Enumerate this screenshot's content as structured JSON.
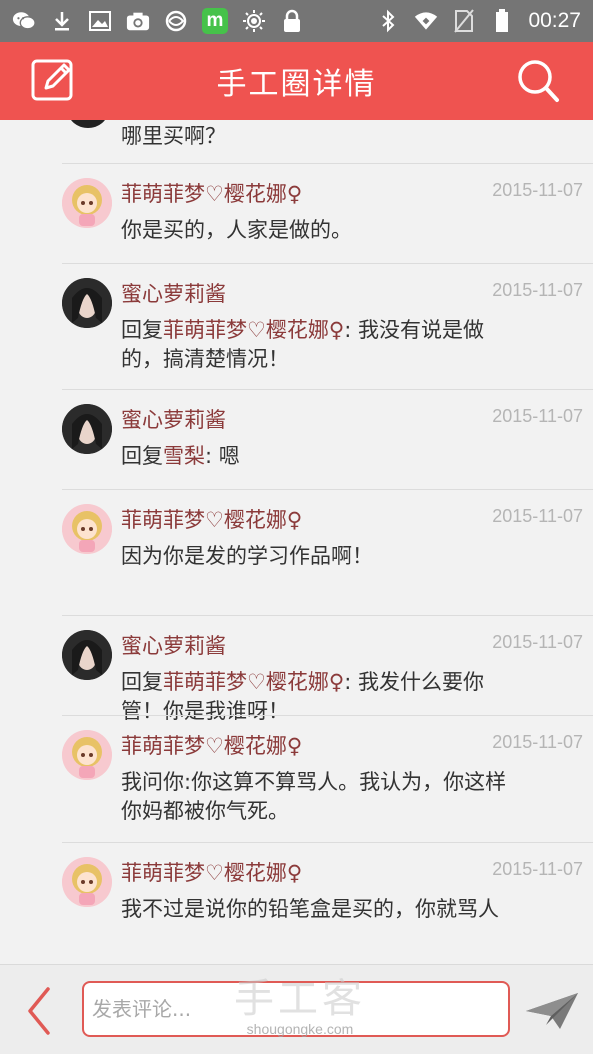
{
  "status_bar": {
    "time": "00:27",
    "left_icons": [
      "wechat-icon",
      "download-icon",
      "image-icon",
      "camera-icon",
      "app-icon",
      "m-app-icon",
      "brightness-icon",
      "lock-icon"
    ],
    "m_badge": "m",
    "right_icons": [
      "bluetooth-icon",
      "wifi-icon",
      "no-sim-icon",
      "battery-icon"
    ]
  },
  "header": {
    "title": "手工圈详情",
    "background": "#ef5350"
  },
  "partial_comment": {
    "text": "哪里买啊？"
  },
  "comments": [
    {
      "user": "菲萌菲梦♡樱花娜♀",
      "date": "2015-11-07",
      "avatar": "girl",
      "reply_prefix": "",
      "reply_to": "",
      "text": "你是买的，人家是做的。"
    },
    {
      "user": "蜜心萝莉酱",
      "date": "2015-11-07",
      "avatar": "photo",
      "reply_prefix": "回复",
      "reply_to": "菲萌菲梦♡樱花娜♀",
      "text": ": 我没有说是做的，搞清楚情况！"
    },
    {
      "user": "蜜心萝莉酱",
      "date": "2015-11-07",
      "avatar": "photo",
      "reply_prefix": "回复",
      "reply_to": "雪梨",
      "text": ": 嗯"
    },
    {
      "user": "菲萌菲梦♡樱花娜♀",
      "date": "2015-11-07",
      "avatar": "girl",
      "reply_prefix": "",
      "reply_to": "",
      "text": "因为你是发的学习作品啊！"
    },
    {
      "user": "蜜心萝莉酱",
      "date": "2015-11-07",
      "avatar": "photo",
      "reply_prefix": "回复",
      "reply_to": "菲萌菲梦♡樱花娜♀",
      "text": ": 我发什么要你管！你是我谁呀！"
    },
    {
      "user": "菲萌菲梦♡樱花娜♀",
      "date": "2015-11-07",
      "avatar": "girl",
      "reply_prefix": "",
      "reply_to": "",
      "text": "我问你:你这算不算骂人。我认为，你这样你妈都被你气死。"
    },
    {
      "user": "菲萌菲梦♡樱花娜♀",
      "date": "2015-11-07",
      "avatar": "girl",
      "reply_prefix": "",
      "reply_to": "",
      "text": "我不过是说你的铅笔盒是买的，你就骂人"
    }
  ],
  "footer": {
    "input_placeholder": "发表评论...",
    "watermark_main": "手工客",
    "watermark_sub": "shougongke.com"
  },
  "colors": {
    "accent": "#ef5350",
    "username": "#8b3a3a",
    "date": "#b5b5b5"
  }
}
